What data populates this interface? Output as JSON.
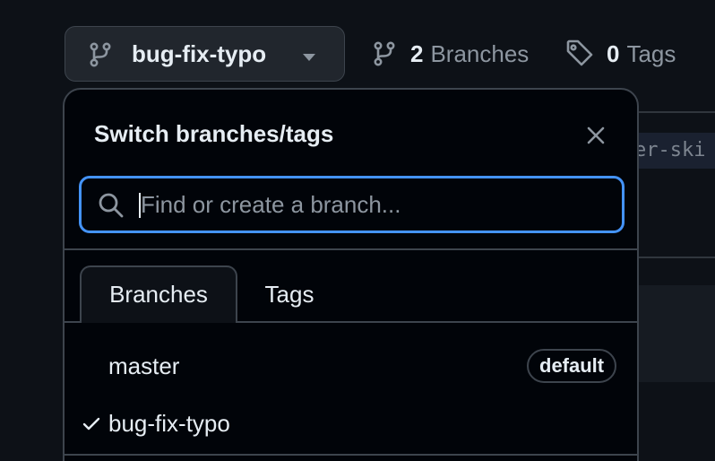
{
  "toolbar": {
    "current_branch": "bug-fix-typo",
    "branches_count": "2",
    "branches_label": "Branches",
    "tags_count": "0",
    "tags_label": "Tags"
  },
  "background": {
    "code_snippet": "er-ski"
  },
  "popup": {
    "title": "Switch branches/tags",
    "search_placeholder": "Find or create a branch...",
    "tabs": [
      {
        "label": "Branches",
        "active": true
      },
      {
        "label": "Tags",
        "active": false
      }
    ],
    "branches": [
      {
        "name": "master",
        "badge": "default",
        "selected": false
      },
      {
        "name": "bug-fix-typo",
        "badge": "",
        "selected": true
      }
    ]
  },
  "icons": {
    "branch": "git-branch-icon",
    "tag": "tag-icon",
    "caret": "triangle-down-icon",
    "close": "x-icon",
    "search": "search-icon",
    "check": "check-icon"
  },
  "colors": {
    "background": "#0d1117",
    "popup_background": "#010409",
    "button_background": "#21262d",
    "border": "#3d444d",
    "focus_ring": "#4493f8",
    "text_primary": "#e6edf3",
    "text_muted": "#8d96a0"
  }
}
